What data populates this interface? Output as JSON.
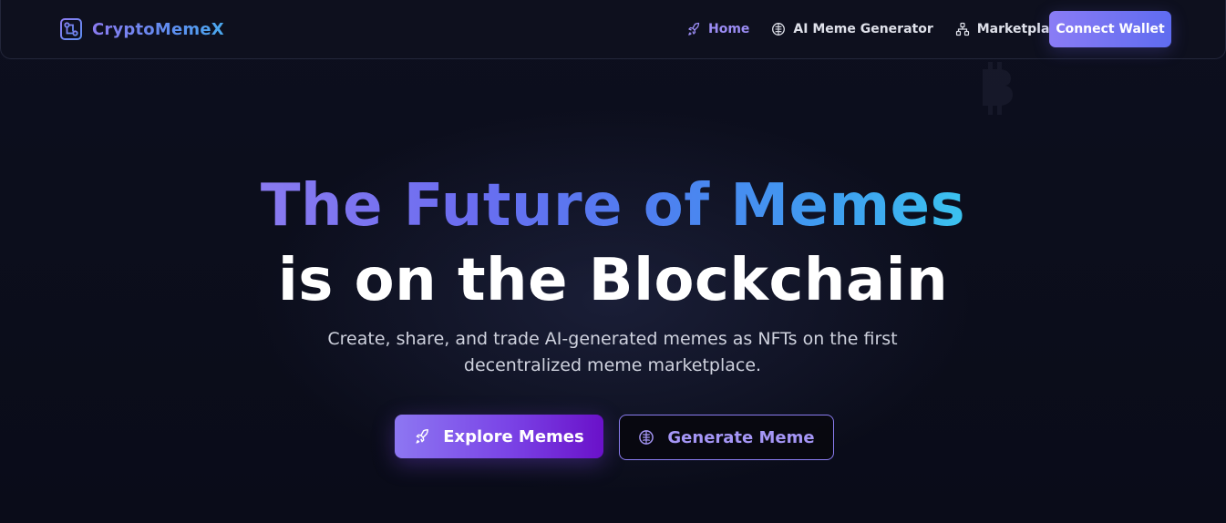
{
  "brand": {
    "name": "CryptoMemeX",
    "icon": "circuit-logo-icon"
  },
  "nav": {
    "items": [
      {
        "label": "Home",
        "icon": "rocket-icon",
        "active": true
      },
      {
        "label": "AI Meme Generator",
        "icon": "brain-icon",
        "active": false
      },
      {
        "label": "Marketplace",
        "icon": "network-icon",
        "active": false
      }
    ],
    "connect_label": "Connect Wallet"
  },
  "hero": {
    "title_line1": "The Future of Memes",
    "title_line2": "is on the Blockchain",
    "subtitle": "Create, share, and trade AI-generated memes as NFTs on the first decentralized meme marketplace.",
    "primary_cta": {
      "label": "Explore Memes",
      "icon": "rocket-icon"
    },
    "secondary_cta": {
      "label": "Generate Meme",
      "icon": "brain-icon"
    }
  },
  "colors": {
    "accent": "#8a7cf5",
    "accent_secondary": "#5f6cf0",
    "background": "#0b0d1a",
    "gradient_end": "#3bc3ef",
    "active_nav": "#9b8cf4"
  }
}
